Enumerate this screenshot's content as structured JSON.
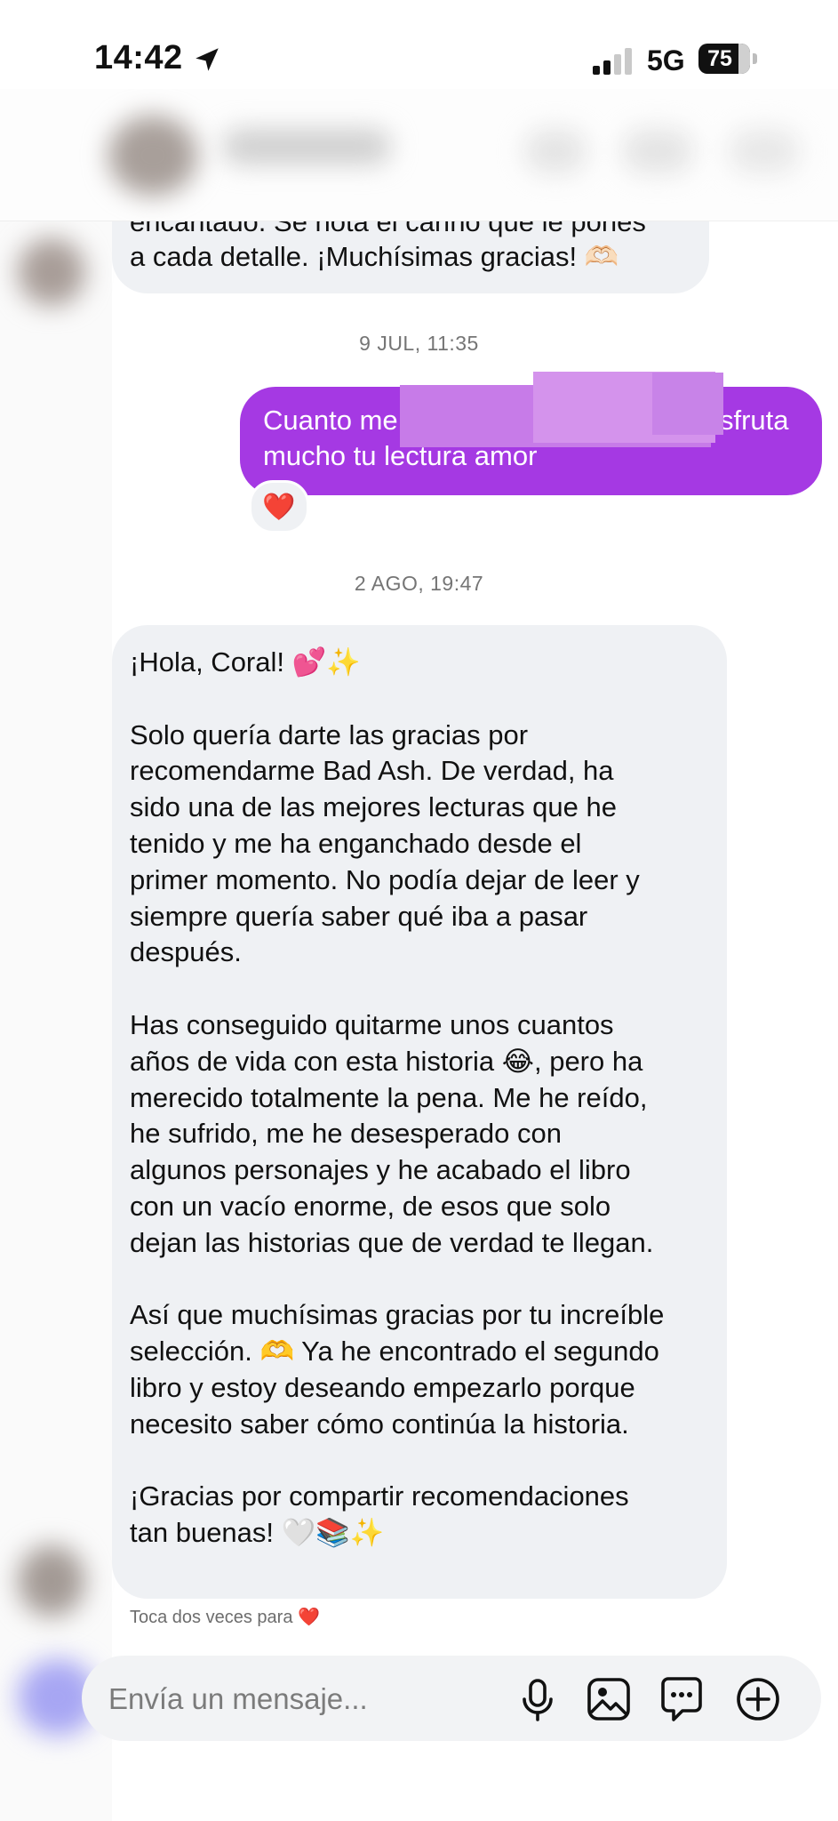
{
  "status_bar": {
    "time": "14:42",
    "network": "5G",
    "battery": "75"
  },
  "messages": {
    "top_partial": {
      "line1": "encantado. Se nota el cariño que le pones",
      "line2": "a cada detalle. ¡Muchísimas gracias! 🫶🏻"
    },
    "date_1": "9 JUL, 11:35",
    "outgoing": {
      "line1_start": "Cuanto me",
      "line1_end": "sfruta",
      "line2": "mucho tu lectura amor",
      "reaction": "❤️"
    },
    "date_2": "2 AGO, 19:47",
    "incoming_long": [
      "¡Hola, Coral! 💕✨",
      "",
      "Solo quería darte las gracias por",
      "recomendarme Bad Ash. De verdad, ha",
      "sido una de las mejores lecturas que he",
      "tenido y me ha enganchado desde el",
      "primer momento. No podía dejar de leer y",
      "siempre quería saber qué iba a pasar",
      "después.",
      "",
      "Has conseguido quitarme unos cuantos",
      "años de vida con esta historia 😂, pero ha",
      "merecido totalmente la pena. Me he reído,",
      "he sufrido, me he desesperado con",
      "algunos personajes y he acabado el libro",
      "con un vacío enorme, de esos que solo",
      "dejan las historias que de verdad te llegan.",
      "",
      "Así que muchísimas gracias por tu increíble",
      "selección. 🫶 Ya he encontrado el segundo",
      "libro y estoy deseando empezarlo porque",
      "necesito saber cómo continúa la historia.",
      "",
      "¡Gracias por compartir recomendaciones",
      "tan buenas! 🤍📚✨"
    ],
    "double_tap_hint": "Toca dos veces para",
    "hint_heart": "❤️"
  },
  "composer": {
    "placeholder": "Envía un mensaje..."
  },
  "icons": [
    "location-arrow-icon",
    "signal-icon",
    "battery-icon",
    "microphone-icon",
    "image-icon",
    "sticker-icon",
    "plus-icon"
  ],
  "colors": {
    "outgoing_bubble": "#a539e3",
    "incoming_bubble": "#eff1f4",
    "heart": "#e41e3f"
  }
}
